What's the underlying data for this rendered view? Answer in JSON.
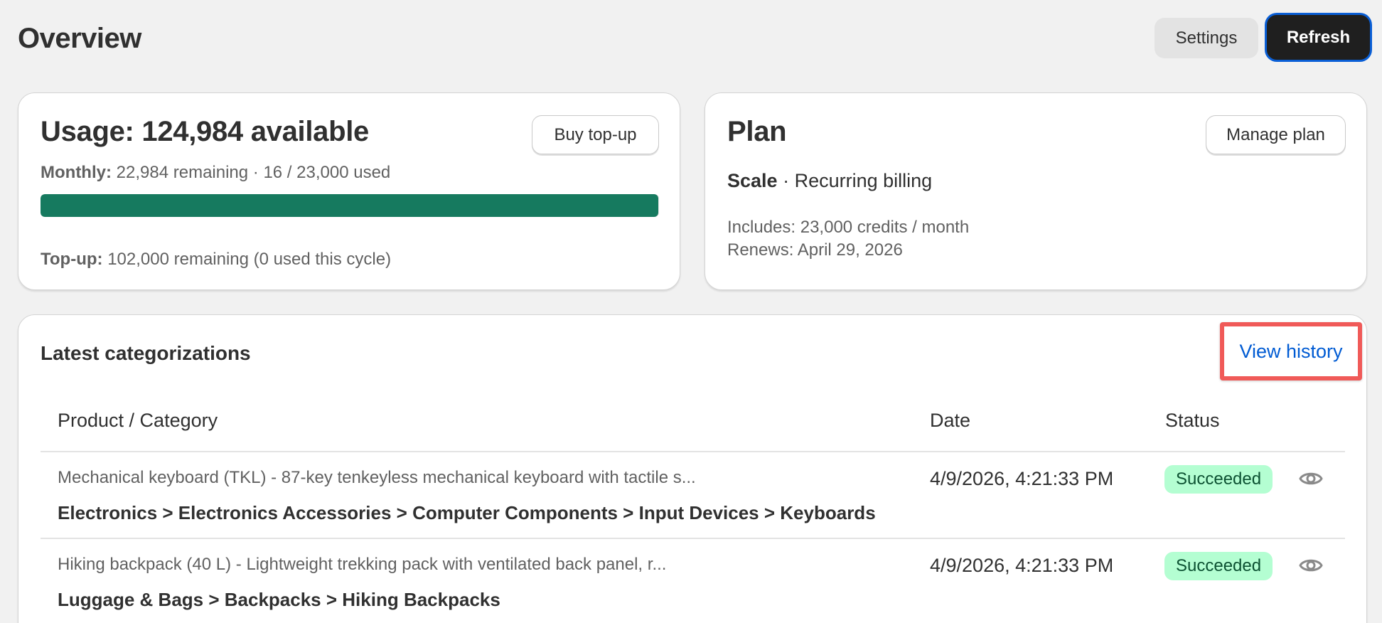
{
  "header": {
    "title": "Overview",
    "settings_label": "Settings",
    "refresh_label": "Refresh"
  },
  "usage": {
    "title": "Usage: 124,984 available",
    "buy_label": "Buy top-up",
    "monthly_label": "Monthly:",
    "monthly_text": "22,984 remaining · 16 / 23,000 used",
    "monthly_remaining_fraction": 0.9993,
    "topup_label": "Top-up:",
    "topup_text": "102,000 remaining (0 used this cycle)"
  },
  "plan": {
    "title": "Plan",
    "manage_label": "Manage plan",
    "tier": "Scale",
    "billing": "· Recurring billing",
    "includes": "Includes: 23,000 credits / month",
    "renews": "Renews: April 29, 2026"
  },
  "latest": {
    "title": "Latest categorizations",
    "history_label": "View history",
    "columns": {
      "product": "Product / Category",
      "date": "Date",
      "status": "Status"
    },
    "rows": [
      {
        "description": "Mechanical keyboard (TKL) - 87-key tenkeyless mechanical keyboard with tactile s...",
        "category": "Electronics > Electronics Accessories > Computer Components > Input Devices > Keyboards",
        "date": "4/9/2026, 4:21:33 PM",
        "status": "Succeeded"
      },
      {
        "description": "Hiking backpack (40 L) - Lightweight trekking pack with ventilated back panel, r...",
        "category": "Luggage & Bags > Backpacks > Hiking Backpacks",
        "date": "4/9/2026, 4:21:33 PM",
        "status": "Succeeded"
      }
    ]
  },
  "colors": {
    "progress": "#167a5f",
    "success_badge_bg": "#b4fed2",
    "link": "#005bd3",
    "highlight": "#f05a58"
  },
  "icons": {
    "row_action": "eye-icon"
  }
}
